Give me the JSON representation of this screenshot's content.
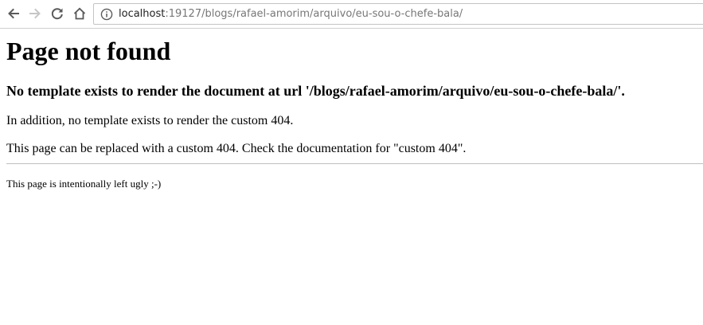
{
  "browser": {
    "address_bar": {
      "host": "localhost",
      "rest": ":19127/blogs/rafael-amorim/arquivo/eu-sou-o-chefe-bala/"
    },
    "icons": {
      "back": "back-arrow-icon",
      "forward": "forward-arrow-icon",
      "reload": "reload-icon",
      "home": "home-icon",
      "info": "info-icon"
    }
  },
  "page": {
    "title": "Page not found",
    "subtitle": "No template exists to render the document at url '/blogs/rafael-amorim/arquivo/eu-sou-o-chefe-bala/'.",
    "paragraph_1": "In addition, no template exists to render the custom 404.",
    "paragraph_2": "This page can be replaced with a custom 404. Check the documentation for \"custom 404\".",
    "footer_note": "This page is intentionally left ugly ;-)"
  }
}
